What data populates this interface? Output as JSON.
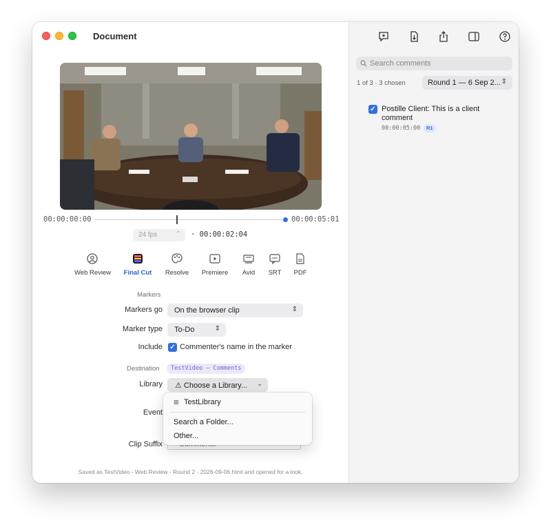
{
  "window": {
    "title": "Document"
  },
  "toolbar": {
    "icons": [
      "add-comment-icon",
      "download-icon",
      "share-icon",
      "sidebar-toggle-icon",
      "help-icon"
    ]
  },
  "player": {
    "start_tc": "00:00:00:00",
    "end_tc": "00:00:05:01",
    "fps": "24 fps",
    "current_tc": "· 00:00:02:04",
    "playhead_progress": 0.43
  },
  "tabs": [
    {
      "label": "Web Review",
      "icon": "web-review-icon"
    },
    {
      "label": "Final Cut",
      "icon": "final-cut-icon"
    },
    {
      "label": "Resolve",
      "icon": "resolve-icon"
    },
    {
      "label": "Premiere",
      "icon": "premiere-icon"
    },
    {
      "label": "Avid",
      "icon": "avid-icon"
    },
    {
      "label": "SRT",
      "icon": "srt-icon"
    },
    {
      "label": "PDF",
      "icon": "pdf-icon"
    }
  ],
  "active_tab": "Final Cut",
  "markers": {
    "section": "Markers",
    "markers_go_label": "Markers go",
    "markers_go_value": "On the browser clip",
    "marker_type_label": "Marker type",
    "marker_type_value": "To-Do",
    "include_label": "Include",
    "include_option": "Commenter's name in the marker"
  },
  "destination": {
    "section": "Destination",
    "badge": "TestVideo — Comments",
    "library_label": "Library",
    "library_value": "⚠ Choose a Library...",
    "event_label": "Event",
    "clip_suffix_label": "Clip Suffix",
    "clip_suffix_value": "Comments"
  },
  "library_menu": {
    "items": [
      "TestLibrary",
      "Search a Folder...",
      "Other..."
    ]
  },
  "footer": "Saved as TestVideo - Web Review - Round 2 - 2026-09-06.html and opened for a look.",
  "sidebar": {
    "search_placeholder": "Search comments",
    "chosen": "1 of 3 · 3 chosen",
    "round": "Round 1 — 6 Sep 2...",
    "comments": [
      {
        "text": "Postille Client: This is a client comment",
        "tc": "00:00:05:00",
        "badge": "R1",
        "checked": true
      }
    ]
  },
  "colors": {
    "accent": "#2f6fe4",
    "purple_badge": "#7a5fd4"
  }
}
